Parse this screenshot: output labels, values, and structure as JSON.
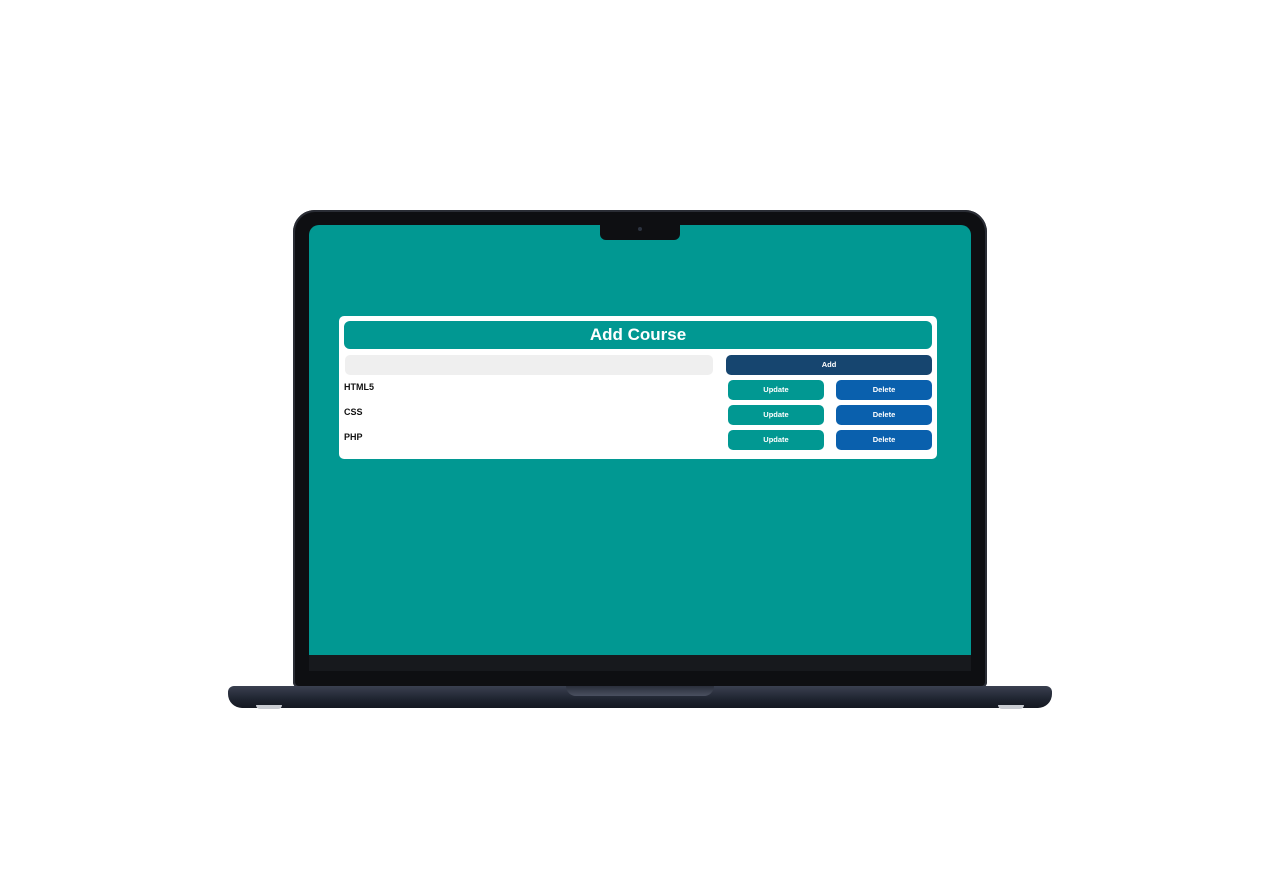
{
  "colors": {
    "screen_bg": "#019892",
    "header_bg": "#019892",
    "add_button": "#16456f",
    "update_button": "#019892",
    "delete_button": "#0a60ad"
  },
  "app": {
    "title": "Add Course",
    "input": {
      "value": "",
      "placeholder": ""
    },
    "add_label": "Add",
    "courses": [
      {
        "name": "HTML5",
        "update_label": "Update",
        "delete_label": "Delete"
      },
      {
        "name": "CSS",
        "update_label": "Update",
        "delete_label": "Delete"
      },
      {
        "name": "PHP",
        "update_label": "Update",
        "delete_label": "Delete"
      }
    ]
  }
}
